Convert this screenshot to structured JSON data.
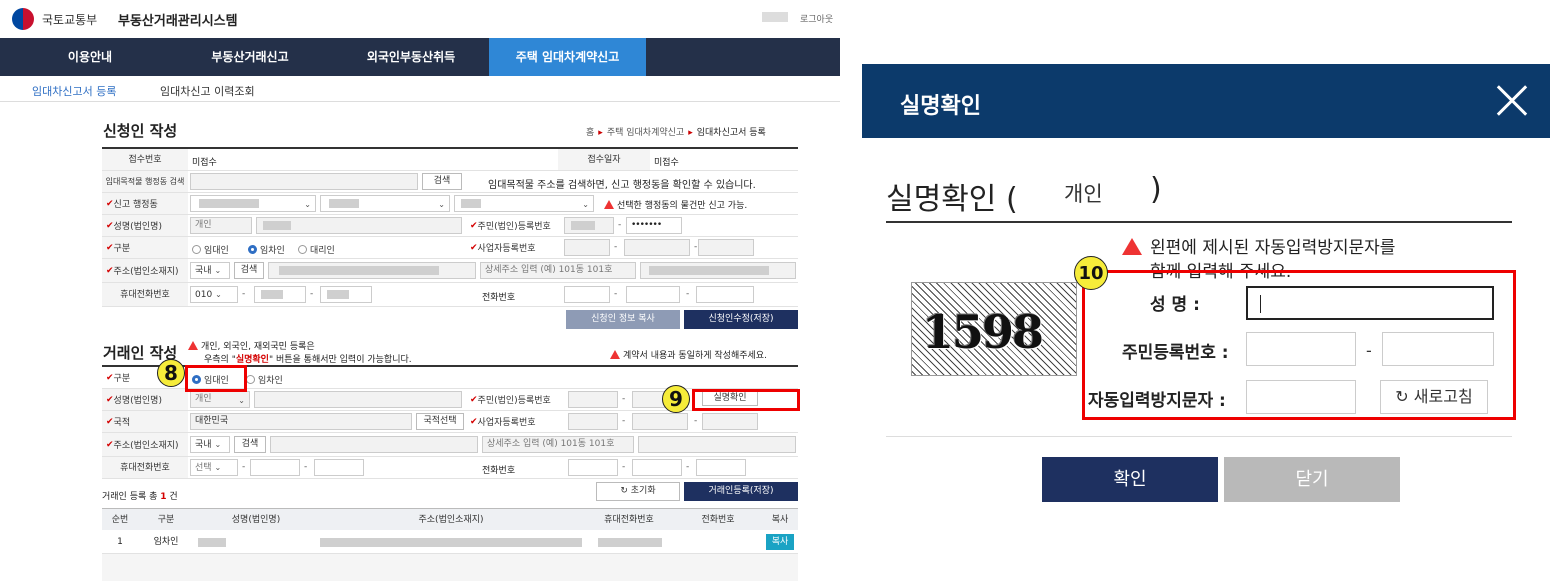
{
  "header": {
    "ministry": "국토교통부",
    "system_title": "부동산거래관리시스템",
    "logout": "로그아웃"
  },
  "gnb": [
    "이용안내",
    "부동산거래신고",
    "외국인부동산취득",
    "주택 임대차계약신고"
  ],
  "snb": [
    "임대차신고서 등록",
    "임대차신고 이력조회"
  ],
  "applicant": {
    "title": "신청인 작성",
    "breadcrumb": [
      "홈",
      "주택 임대차계약신고",
      "임대차신고서 등록"
    ],
    "receipt_no_label": "접수번호",
    "receipt_no": "미접수",
    "receipt_date_label": "접수일자",
    "receipt_date": "미접수",
    "addr_search_label": "임대목적물 행정동 검색",
    "search_btn": "검색",
    "addr_search_note": "임대목적물 주소를 검색하면, 신고 행정동을 확인할 수 있습니다.",
    "admin_dong_label": "신고 행정동",
    "admin_dong_note": "선택한 행정동의 물건만 신고 가능.",
    "name_label": "성명(법인명)",
    "name_type": "개인",
    "rrn_label": "주민(법인)등록번호",
    "rrn_mask": "•••••••",
    "type_label": "구분",
    "type_options": [
      "임대인",
      "임차인",
      "대리인"
    ],
    "bizno_label": "사업자등록번호",
    "addr_label": "주소(법인소재지)",
    "country": "국내",
    "addr_detail_placeholder": "상세주소 입력 (예) 101동 101호",
    "mobile_label": "휴대전화번호",
    "mobile_prefix": "010",
    "phone_label": "전화번호",
    "copy_btn": "신청인 정보 복사",
    "save_btn": "신청인수정(저장)"
  },
  "party": {
    "title": "거래인 작성",
    "notice_line1": "개인, 외국인, 재외국민 등록은",
    "notice_line2_pre": "우측의 \"",
    "notice_highlight": "실명확인",
    "notice_line2_post": "\" 버튼을 통해서만 입력이 가능합니다.",
    "right_notice": "계약서 내용과 동일하게 작성해주세요.",
    "type_label": "구분",
    "type_options": [
      "임대인",
      "임차인"
    ],
    "name_label": "성명(법인명)",
    "name_type": "개인",
    "rrn_label": "주민(법인)등록번호",
    "verify_btn": "실명확인",
    "nation_label": "국적",
    "nation_value": "대한민국",
    "nation_btn": "국적선택",
    "bizno_label": "사업자등록번호",
    "addr_label": "주소(법인소재지)",
    "country": "국내",
    "search_btn": "검색",
    "addr_detail_placeholder": "상세주소 입력 (예) 101동 101호",
    "mobile_label": "휴대전화번호",
    "mobile_select": "선택",
    "phone_label": "전화번호",
    "count_pre": "거래인 등록 총",
    "count": "1",
    "count_unit": "건",
    "reset_btn": "초기화",
    "register_btn": "거래인등록(저장)"
  },
  "table": {
    "headers": [
      "순번",
      "구분",
      "성명(법인명)",
      "주소(법인소재지)",
      "휴대전화번호",
      "전화번호",
      "복사"
    ],
    "rows": [
      {
        "no": "1",
        "type": "임차인",
        "copy": "복사"
      }
    ]
  },
  "callouts": [
    "8",
    "9",
    "10"
  ],
  "dialog": {
    "title": "실명확인",
    "heading": "실명확인",
    "paren_open": "(",
    "heading_type": "개인",
    "paren_close": ")",
    "warn_line1": "왼편에 제시된 자동입력방지문자를",
    "warn_line2": "함께 입력해 주세요.",
    "captcha_text": "1598",
    "name_label": "성      명 :",
    "rrn_label": "주민등록번호 :",
    "captcha_label": "자동입력방지문자 :",
    "refresh_btn": "새로고침",
    "ok_btn": "확인",
    "cancel_btn": "닫기"
  },
  "colors": {
    "nav": "#243049",
    "nav_active": "#2f87d6",
    "dialog_head": "#0c3a6b",
    "primary_btn": "#1e3060",
    "callout_box": "#e00000",
    "callout_circle": "#f6ec3a"
  }
}
